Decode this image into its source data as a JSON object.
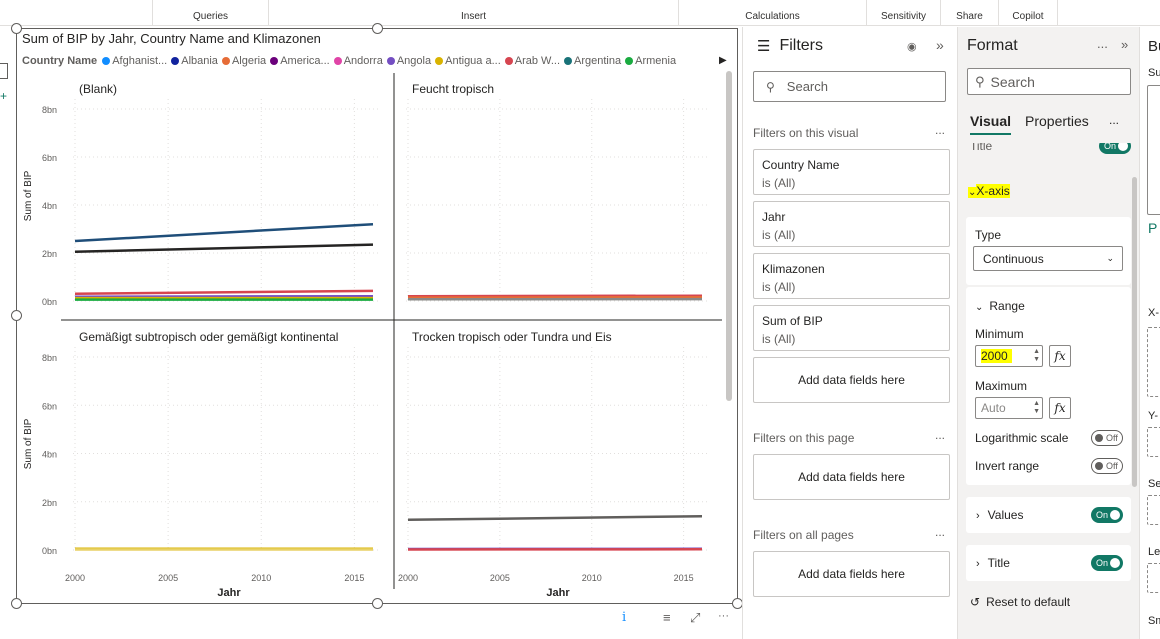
{
  "ribbon": {
    "groups": [
      "Queries",
      "Insert",
      "Calculations",
      "Sensitivity",
      "Share",
      "Copilot"
    ]
  },
  "visual": {
    "title": "Sum of BIP by Jahr, Country Name and Klimazonen",
    "legend_title": "Country Name",
    "legend_items": [
      {
        "label": "Afghanist...",
        "color": "#118dff"
      },
      {
        "label": "Albania",
        "color": "#12239e"
      },
      {
        "label": "Algeria",
        "color": "#e66c37"
      },
      {
        "label": "America...",
        "color": "#6b007b"
      },
      {
        "label": "Andorra",
        "color": "#e044a7"
      },
      {
        "label": "Angola",
        "color": "#744ec2"
      },
      {
        "label": "Antigua a...",
        "color": "#d9b300"
      },
      {
        "label": "Arab W...",
        "color": "#d64550"
      },
      {
        "label": "Argentina",
        "color": "#197278"
      },
      {
        "label": "Armenia",
        "color": "#1aab40"
      }
    ]
  },
  "chart_data": {
    "type": "line",
    "title": "Sum of BIP by Jahr, Country Name and Klimazonen",
    "xlabel": "Jahr",
    "ylabel": "Sum of BIP",
    "x_ticks": [
      "2000",
      "2005",
      "2010",
      "2015"
    ],
    "y_ticks": [
      "0bn",
      "2bn",
      "4bn",
      "6bn",
      "8bn"
    ],
    "xlim": [
      2000,
      2016
    ],
    "ylim": [
      0,
      8
    ],
    "grid": true,
    "legend_position": "top",
    "panels": [
      {
        "title": "(Blank)",
        "series": [
          {
            "color": "#1f4e79",
            "points": [
              [
                2000,
                2.5
              ],
              [
                2016,
                3.2
              ]
            ]
          },
          {
            "color": "#252423",
            "points": [
              [
                2000,
                2.05
              ],
              [
                2016,
                2.35
              ]
            ]
          },
          {
            "color": "#d64550",
            "points": [
              [
                2000,
                0.3
              ],
              [
                2016,
                0.42
              ]
            ]
          },
          {
            "color": "#744ec2",
            "points": [
              [
                2000,
                0.18
              ],
              [
                2016,
                0.2
              ]
            ]
          },
          {
            "color": "#d9b300",
            "points": [
              [
                2000,
                0.12
              ],
              [
                2016,
                0.12
              ]
            ]
          },
          {
            "color": "#1aab40",
            "points": [
              [
                2000,
                0.06
              ],
              [
                2016,
                0.06
              ]
            ]
          }
        ]
      },
      {
        "title": "Feucht tropisch",
        "series": [
          {
            "color": "#d64550",
            "points": [
              [
                2000,
                0.2
              ],
              [
                2016,
                0.22
              ]
            ]
          },
          {
            "color": "#e66c37",
            "points": [
              [
                2000,
                0.14
              ],
              [
                2016,
                0.16
              ]
            ]
          },
          {
            "color": "#8a8886",
            "points": [
              [
                2000,
                0.07
              ],
              [
                2016,
                0.08
              ]
            ]
          }
        ]
      },
      {
        "title": "Gemäßigt subtropisch oder gemäßigt kontinental",
        "series": [
          {
            "color": "#d9b300",
            "points": [
              [
                2000,
                0.05
              ],
              [
                2016,
                0.05
              ]
            ]
          },
          {
            "color": "#e8d166",
            "points": [
              [
                2000,
                0.02
              ],
              [
                2016,
                0.02
              ]
            ]
          }
        ]
      },
      {
        "title": "Trocken tropisch oder Tundra und Eis",
        "series": [
          {
            "color": "#605e5c",
            "points": [
              [
                2000,
                1.25
              ],
              [
                2016,
                1.4
              ]
            ]
          },
          {
            "color": "#744ec2",
            "points": [
              [
                2000,
                0.04
              ],
              [
                2016,
                0.05
              ]
            ]
          },
          {
            "color": "#d64550",
            "points": [
              [
                2000,
                0.02
              ],
              [
                2016,
                0.03
              ]
            ]
          }
        ]
      }
    ]
  },
  "filters": {
    "title": "Filters",
    "search_placeholder": "Search",
    "on_visual_label": "Filters on this visual",
    "on_page_label": "Filters on this page",
    "all_pages_label": "Filters on all pages",
    "more": "...",
    "add_label": "Add data fields here",
    "cards": [
      {
        "name": "Country Name",
        "state": "is (All)"
      },
      {
        "name": "Jahr",
        "state": "is (All)"
      },
      {
        "name": "Klimazonen",
        "state": "is (All)"
      },
      {
        "name": "Sum of BIP",
        "state": "is (All)"
      }
    ]
  },
  "format": {
    "title": "Format",
    "more": "...",
    "search_placeholder": "Search",
    "tabs": [
      "Visual",
      "Properties"
    ],
    "title_section": "Title",
    "xaxis_section": "X-axis",
    "type_label": "Type",
    "type_value": "Continuous",
    "range_label": "Range",
    "minimum_label": "Minimum",
    "minimum_value": "2000",
    "maximum_label": "Maximum",
    "maximum_placeholder": "Auto",
    "log_scale_label": "Logarithmic scale",
    "invert_label": "Invert range",
    "values_label": "Values",
    "title_label": "Title",
    "on": "On",
    "off": "Off",
    "reset": "Reset to default",
    "fx": "fx"
  },
  "build": {
    "header": "Bu",
    "labels": [
      "Su",
      "P",
      "X-",
      "Y-",
      "Se",
      "Le",
      "Sm"
    ]
  }
}
